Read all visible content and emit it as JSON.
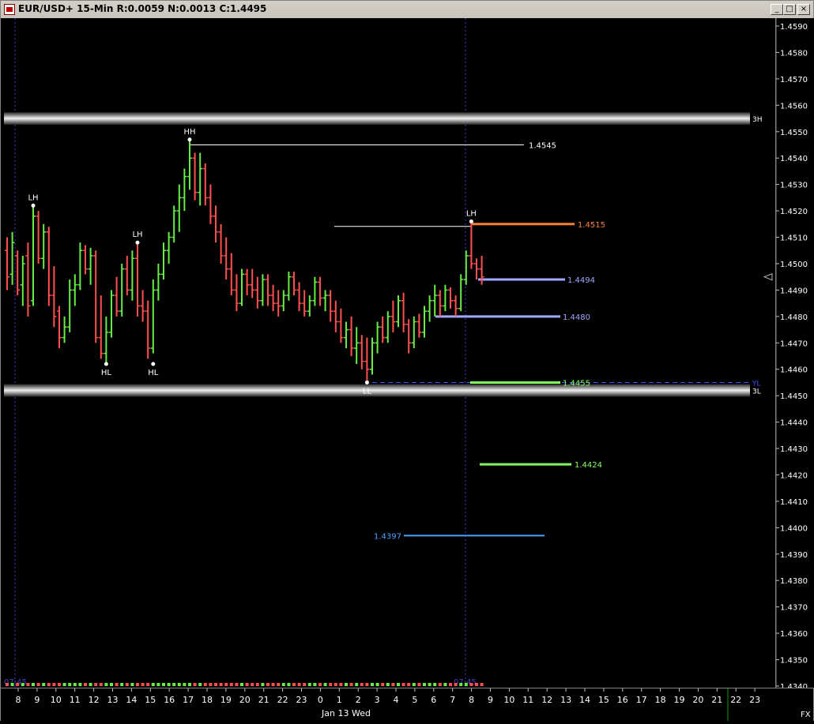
{
  "window": {
    "title": "EUR/USD+ 15-Min R:0.0059 N:0.0013 C:1.4495",
    "buttons": [
      "_",
      "□",
      "×"
    ]
  },
  "chart_data": {
    "type": "candlestick",
    "symbol": "EUR/USD+",
    "interval": "15-Min",
    "ylim": [
      1.434,
      1.4595
    ],
    "y_ticks": [
      "1.4590",
      "1.4580",
      "1.4570",
      "1.4560",
      "1.4550",
      "1.4540",
      "1.4530",
      "1.4520",
      "1.4510",
      "1.4500",
      "1.4490",
      "1.4480",
      "1.4470",
      "1.4460",
      "1.4450",
      "1.4440",
      "1.4430",
      "1.4420",
      "1.4410",
      "1.4400",
      "1.4390",
      "1.4380",
      "1.4370",
      "1.4360",
      "1.4350",
      "1.4340"
    ],
    "x_ticks": [
      "8",
      "9",
      "10",
      "11",
      "12",
      "13",
      "14",
      "15",
      "16",
      "17",
      "18",
      "19",
      "20",
      "21",
      "22",
      "23",
      "0",
      "1",
      "2",
      "3",
      "4",
      "5",
      "6",
      "7",
      "8",
      "9",
      "10",
      "11",
      "12",
      "13",
      "14",
      "15",
      "16",
      "17",
      "18",
      "19",
      "20",
      "21",
      "22",
      "23"
    ],
    "date_label": "Jan 13 Wed",
    "corner_label": "FX",
    "session_labels": [
      "07:45",
      "07:45"
    ],
    "zones": [
      {
        "label": "3H",
        "price": 1.4555
      },
      {
        "label": "3L",
        "price": 1.4452
      }
    ],
    "levels": [
      {
        "label": "1.4545",
        "price": 1.4545,
        "color": "#ffffff"
      },
      {
        "label": "1.4515",
        "price": 1.4515,
        "color": "#ff8030"
      },
      {
        "label": "1.4494",
        "price": 1.4494,
        "color": "#a0a8ff"
      },
      {
        "label": "1.4480",
        "price": 1.448,
        "color": "#a0a8ff"
      },
      {
        "label": "1.4455",
        "price": 1.4455,
        "color": "#80ff60"
      },
      {
        "label": "1.4424",
        "price": 1.4424,
        "color": "#80ff60"
      },
      {
        "label": "1.4397",
        "price": 1.4397,
        "color": "#4aa0ff"
      }
    ],
    "yl_label": "YL",
    "swing_labels": [
      {
        "text": "LH",
        "bar": 5,
        "price": 1.4522
      },
      {
        "text": "HL",
        "bar": 19,
        "price": 1.4462
      },
      {
        "text": "LH",
        "bar": 25,
        "price": 1.4508
      },
      {
        "text": "HL",
        "bar": 28,
        "price": 1.4462
      },
      {
        "text": "HH",
        "bar": 35,
        "price": 1.4547
      },
      {
        "text": "LL",
        "bar": 69,
        "price": 1.4455
      },
      {
        "text": "LH",
        "bar": 89,
        "price": 1.4516
      }
    ],
    "current_price": 1.4495,
    "bars": [
      [
        1.4505,
        1.451,
        1.449,
        1.4495
      ],
      [
        1.4496,
        1.4512,
        1.4492,
        1.4508
      ],
      [
        1.4503,
        1.4505,
        1.4488,
        1.449
      ],
      [
        1.4492,
        1.4503,
        1.4484,
        1.45
      ],
      [
        1.4503,
        1.4508,
        1.448,
        1.4484
      ],
      [
        1.4486,
        1.4522,
        1.4484,
        1.4518
      ],
      [
        1.4518,
        1.452,
        1.45,
        1.4502
      ],
      [
        1.4502,
        1.4515,
        1.4498,
        1.4512
      ],
      [
        1.4512,
        1.4514,
        1.4484,
        1.4488
      ],
      [
        1.4488,
        1.4499,
        1.4476,
        1.448
      ],
      [
        1.4482,
        1.4484,
        1.4468,
        1.4472
      ],
      [
        1.4472,
        1.448,
        1.447,
        1.4476
      ],
      [
        1.4476,
        1.4494,
        1.4474,
        1.449
      ],
      [
        1.449,
        1.4496,
        1.4484,
        1.4492
      ],
      [
        1.4492,
        1.4508,
        1.449,
        1.4505
      ],
      [
        1.4505,
        1.4507,
        1.4496,
        1.4498
      ],
      [
        1.4498,
        1.4506,
        1.4492,
        1.4503
      ],
      [
        1.4503,
        1.4505,
        1.447,
        1.4472
      ],
      [
        1.4472,
        1.4488,
        1.4464,
        1.4466
      ],
      [
        1.4466,
        1.448,
        1.4462,
        1.4474
      ],
      [
        1.4474,
        1.449,
        1.4472,
        1.4488
      ],
      [
        1.4488,
        1.4495,
        1.448,
        1.4482
      ],
      [
        1.4482,
        1.45,
        1.448,
        1.4498
      ],
      [
        1.4498,
        1.4503,
        1.4488,
        1.449
      ],
      [
        1.449,
        1.4505,
        1.4486,
        1.4502
      ],
      [
        1.4502,
        1.4508,
        1.448,
        1.4484
      ],
      [
        1.4484,
        1.449,
        1.4478,
        1.4482
      ],
      [
        1.4482,
        1.4486,
        1.4464,
        1.4468
      ],
      [
        1.4468,
        1.4494,
        1.4466,
        1.449
      ],
      [
        1.449,
        1.45,
        1.4486,
        1.4496
      ],
      [
        1.4496,
        1.4508,
        1.4494,
        1.4505
      ],
      [
        1.4505,
        1.4512,
        1.45,
        1.451
      ],
      [
        1.451,
        1.4522,
        1.4508,
        1.452
      ],
      [
        1.452,
        1.453,
        1.4512,
        1.4525
      ],
      [
        1.4525,
        1.4536,
        1.452,
        1.4533
      ],
      [
        1.4533,
        1.4547,
        1.4528,
        1.454
      ],
      [
        1.454,
        1.4542,
        1.4524,
        1.4527
      ],
      [
        1.4527,
        1.4542,
        1.4522,
        1.4536
      ],
      [
        1.4536,
        1.4538,
        1.4522,
        1.4525
      ],
      [
        1.4525,
        1.453,
        1.4515,
        1.4518
      ],
      [
        1.4518,
        1.4522,
        1.4508,
        1.4512
      ],
      [
        1.4512,
        1.4515,
        1.45,
        1.4503
      ],
      [
        1.4503,
        1.451,
        1.4494,
        1.4498
      ],
      [
        1.4498,
        1.4504,
        1.4488,
        1.449
      ],
      [
        1.449,
        1.4496,
        1.4482,
        1.4485
      ],
      [
        1.4485,
        1.4498,
        1.4484,
        1.4496
      ],
      [
        1.4496,
        1.4498,
        1.4488,
        1.4492
      ],
      [
        1.4492,
        1.4498,
        1.4487,
        1.449
      ],
      [
        1.449,
        1.4495,
        1.4483,
        1.4486
      ],
      [
        1.4486,
        1.4496,
        1.4484,
        1.4494
      ],
      [
        1.4494,
        1.4496,
        1.4484,
        1.4488
      ],
      [
        1.4488,
        1.4492,
        1.4482,
        1.4485
      ],
      [
        1.4485,
        1.449,
        1.448,
        1.4484
      ],
      [
        1.4484,
        1.449,
        1.4482,
        1.4488
      ],
      [
        1.4488,
        1.4497,
        1.4486,
        1.4495
      ],
      [
        1.4495,
        1.4497,
        1.4488,
        1.449
      ],
      [
        1.449,
        1.4493,
        1.4482,
        1.4485
      ],
      [
        1.4485,
        1.449,
        1.448,
        1.4482
      ],
      [
        1.4482,
        1.4488,
        1.448,
        1.4486
      ],
      [
        1.4486,
        1.4495,
        1.4484,
        1.4493
      ],
      [
        1.4493,
        1.4495,
        1.4484,
        1.4487
      ],
      [
        1.4487,
        1.449,
        1.4482,
        1.4488
      ],
      [
        1.4488,
        1.449,
        1.4478,
        1.4482
      ],
      [
        1.4482,
        1.4486,
        1.4474,
        1.4478
      ],
      [
        1.4478,
        1.4483,
        1.447,
        1.4472
      ],
      [
        1.4472,
        1.4478,
        1.4468,
        1.4475
      ],
      [
        1.4475,
        1.448,
        1.4465,
        1.4468
      ],
      [
        1.4468,
        1.4476,
        1.4462,
        1.447
      ],
      [
        1.447,
        1.4473,
        1.446,
        1.4463
      ],
      [
        1.4463,
        1.4472,
        1.4455,
        1.446
      ],
      [
        1.446,
        1.4472,
        1.4458,
        1.447
      ],
      [
        1.447,
        1.4478,
        1.4466,
        1.4476
      ],
      [
        1.4476,
        1.448,
        1.447,
        1.4472
      ],
      [
        1.4472,
        1.4482,
        1.447,
        1.448
      ],
      [
        1.448,
        1.4486,
        1.4474,
        1.4478
      ],
      [
        1.4478,
        1.4488,
        1.4476,
        1.4486
      ],
      [
        1.4486,
        1.4489,
        1.4474,
        1.4477
      ],
      [
        1.4477,
        1.4479,
        1.4466,
        1.447
      ],
      [
        1.447,
        1.448,
        1.4468,
        1.4478
      ],
      [
        1.4478,
        1.4481,
        1.4472,
        1.4474
      ],
      [
        1.4474,
        1.4484,
        1.4472,
        1.4482
      ],
      [
        1.4482,
        1.4488,
        1.4478,
        1.4486
      ],
      [
        1.4486,
        1.4492,
        1.448,
        1.4488
      ],
      [
        1.4488,
        1.449,
        1.448,
        1.4484
      ],
      [
        1.4484,
        1.4492,
        1.4482,
        1.449
      ],
      [
        1.449,
        1.4491,
        1.4483,
        1.4486
      ],
      [
        1.4486,
        1.4488,
        1.448,
        1.4483
      ],
      [
        1.4483,
        1.4496,
        1.4482,
        1.4494
      ],
      [
        1.4494,
        1.4505,
        1.4492,
        1.4503
      ],
      [
        1.4503,
        1.4516,
        1.4498,
        1.45
      ],
      [
        1.45,
        1.4502,
        1.4494,
        1.4498
      ],
      [
        1.4498,
        1.4503,
        1.4492,
        1.4495
      ]
    ],
    "colors": {
      "up": "#66ee44",
      "down": "#ff5050",
      "background": "#000000",
      "grid": "#4040c0",
      "axis_text": "#ffffff"
    }
  }
}
